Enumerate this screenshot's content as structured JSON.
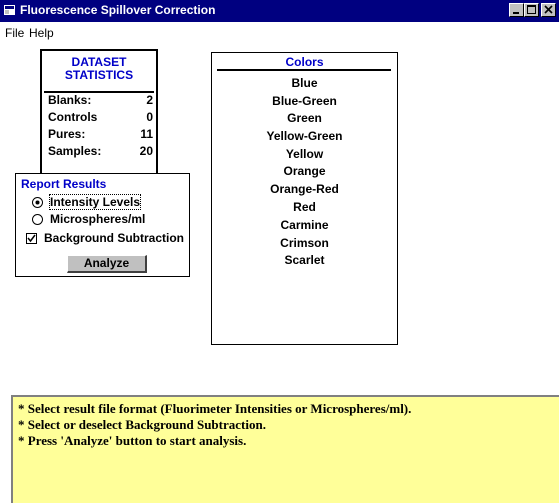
{
  "window": {
    "title": "Fluorescence Spillover Correction"
  },
  "menu": {
    "items": [
      "File",
      "Help"
    ]
  },
  "dataset_statistics": {
    "title_line1": "DATASET",
    "title_line2": "STATISTICS",
    "rows": [
      {
        "label": "Blanks:",
        "value": "2"
      },
      {
        "label": "Controls",
        "value": "0"
      },
      {
        "label": "Pures:",
        "value": "11"
      },
      {
        "label": "Samples:",
        "value": "20"
      }
    ]
  },
  "report_results": {
    "title": "Report Results",
    "options": [
      {
        "label": "Intensity Levels",
        "selected": true
      },
      {
        "label": "Microspheres/ml",
        "selected": false
      }
    ],
    "background_subtraction": {
      "label": "Background Subtraction",
      "checked": true
    },
    "analyze_label": "Analyze"
  },
  "colors": {
    "header": "Colors",
    "items": [
      "Blue",
      "Blue-Green",
      "Green",
      "Yellow-Green",
      "Yellow",
      "Orange",
      "Orange-Red",
      "Red",
      "Carmine",
      "Crimson",
      "Scarlet"
    ]
  },
  "instructions": {
    "lines": [
      "* Select result file format (Fluorimeter Intensities or Microspheres/ml).",
      "* Select or deselect Background Subtraction.",
      "* Press 'Analyze' button to start analysis."
    ]
  },
  "theme": {
    "titlebar": "#000080",
    "heading": "#0000c8",
    "instructions_bg": "#ffff99",
    "button_face": "#c0c0c0"
  }
}
